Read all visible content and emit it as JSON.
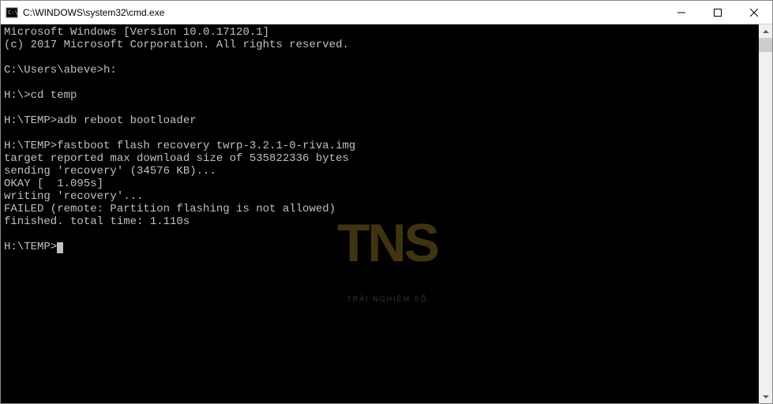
{
  "window": {
    "title": "C:\\WINDOWS\\system32\\cmd.exe"
  },
  "terminal": {
    "lines": [
      "Microsoft Windows [Version 10.0.17120.1]",
      "(c) 2017 Microsoft Corporation. All rights reserved.",
      "",
      "C:\\Users\\abeve>h:",
      "",
      "H:\\>cd temp",
      "",
      "H:\\TEMP>adb reboot bootloader",
      "",
      "H:\\TEMP>fastboot flash recovery twrp-3.2.1-0-riva.img",
      "target reported max download size of 535822336 bytes",
      "sending 'recovery' (34576 KB)...",
      "OKAY [  1.095s]",
      "writing 'recovery'...",
      "FAILED (remote: Partition flashing is not allowed)",
      "finished. total time: 1.110s",
      "",
      "H:\\TEMP>"
    ]
  },
  "watermark": {
    "logo": "TNS",
    "tagline": "TRẢI NGHIỆM SỐ"
  }
}
